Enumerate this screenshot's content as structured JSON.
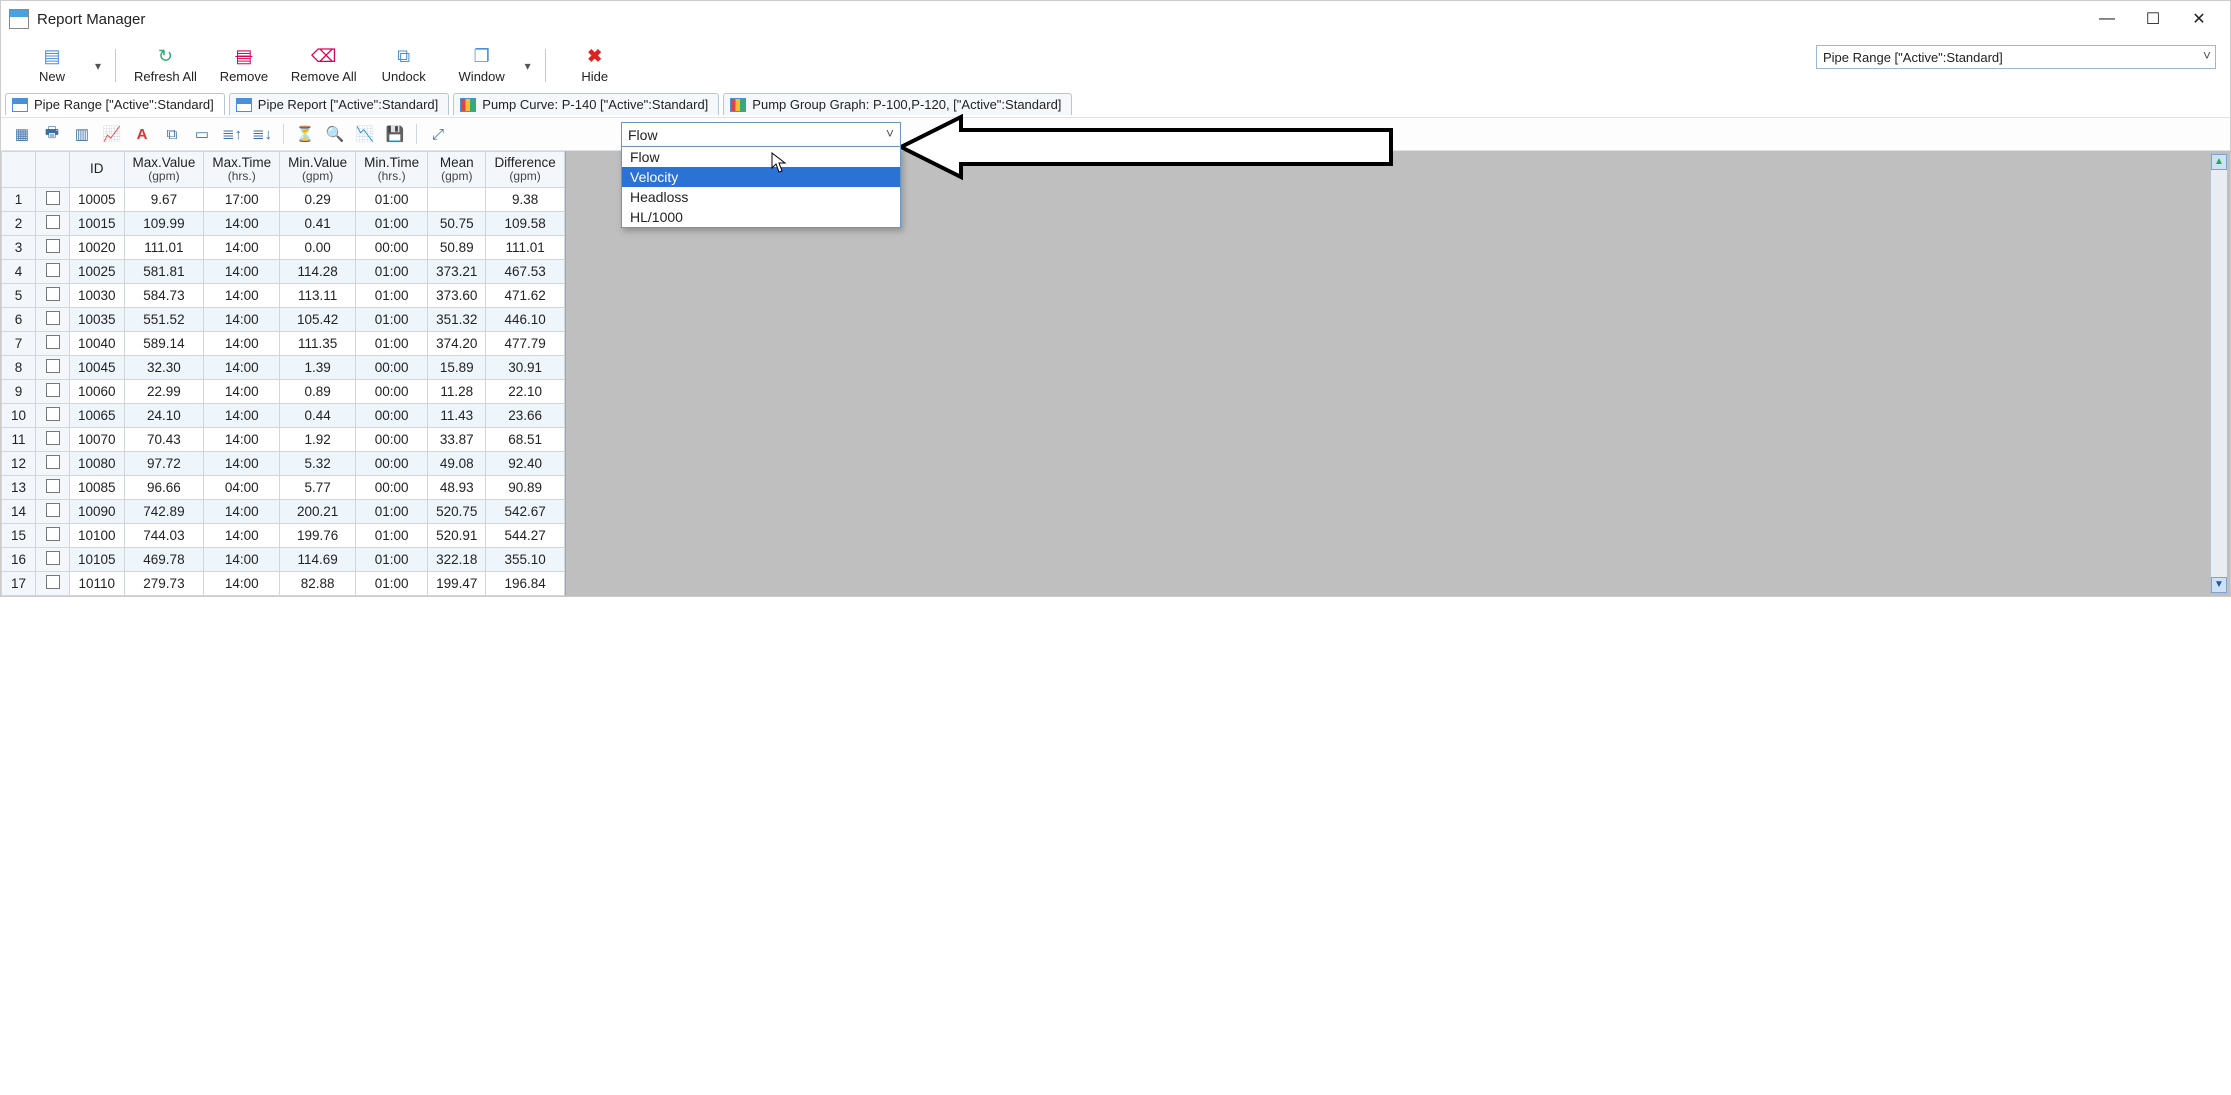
{
  "window": {
    "title": "Report Manager"
  },
  "toolbar": {
    "new": "New",
    "refresh_all": "Refresh All",
    "remove": "Remove",
    "remove_all": "Remove All",
    "undock": "Undock",
    "window": "Window",
    "hide": "Hide"
  },
  "top_combo": {
    "value": "Pipe Range [\"Active\":Standard]"
  },
  "tabs": [
    {
      "label": "Pipe Range [\"Active\":Standard]",
      "type": "table",
      "active": true
    },
    {
      "label": "Pipe Report [\"Active\":Standard]",
      "type": "table",
      "active": false
    },
    {
      "label": "Pump Curve: P-140 [\"Active\":Standard]",
      "type": "chart",
      "active": false
    },
    {
      "label": "Pump Group Graph: P-100,P-120, [\"Active\":Standard]",
      "type": "chart",
      "active": false
    }
  ],
  "attr_combo": {
    "selected": "Flow",
    "options": [
      "Flow",
      "Velocity",
      "Headloss",
      "HL/1000"
    ],
    "highlighted_index": 1
  },
  "columns": [
    {
      "title": "ID",
      "sub": ""
    },
    {
      "title": "Max.Value",
      "sub": "(gpm)"
    },
    {
      "title": "Max.Time",
      "sub": "(hrs.)"
    },
    {
      "title": "Min.Value",
      "sub": "(gpm)"
    },
    {
      "title": "Min.Time",
      "sub": "(hrs.)"
    },
    {
      "title": "Mean",
      "sub": "(gpm)"
    },
    {
      "title": "Difference",
      "sub": "(gpm)"
    }
  ],
  "rows": [
    {
      "n": 1,
      "id": "10005",
      "maxv": "9.67",
      "maxt": "17:00",
      "minv": "0.29",
      "mint": "01:00",
      "mean": "",
      "diff": "9.38"
    },
    {
      "n": 2,
      "id": "10015",
      "maxv": "109.99",
      "maxt": "14:00",
      "minv": "0.41",
      "mint": "01:00",
      "mean": "50.75",
      "diff": "109.58"
    },
    {
      "n": 3,
      "id": "10020",
      "maxv": "111.01",
      "maxt": "14:00",
      "minv": "0.00",
      "mint": "00:00",
      "mean": "50.89",
      "diff": "111.01"
    },
    {
      "n": 4,
      "id": "10025",
      "maxv": "581.81",
      "maxt": "14:00",
      "minv": "114.28",
      "mint": "01:00",
      "mean": "373.21",
      "diff": "467.53"
    },
    {
      "n": 5,
      "id": "10030",
      "maxv": "584.73",
      "maxt": "14:00",
      "minv": "113.11",
      "mint": "01:00",
      "mean": "373.60",
      "diff": "471.62"
    },
    {
      "n": 6,
      "id": "10035",
      "maxv": "551.52",
      "maxt": "14:00",
      "minv": "105.42",
      "mint": "01:00",
      "mean": "351.32",
      "diff": "446.10"
    },
    {
      "n": 7,
      "id": "10040",
      "maxv": "589.14",
      "maxt": "14:00",
      "minv": "111.35",
      "mint": "01:00",
      "mean": "374.20",
      "diff": "477.79"
    },
    {
      "n": 8,
      "id": "10045",
      "maxv": "32.30",
      "maxt": "14:00",
      "minv": "1.39",
      "mint": "00:00",
      "mean": "15.89",
      "diff": "30.91"
    },
    {
      "n": 9,
      "id": "10060",
      "maxv": "22.99",
      "maxt": "14:00",
      "minv": "0.89",
      "mint": "00:00",
      "mean": "11.28",
      "diff": "22.10"
    },
    {
      "n": 10,
      "id": "10065",
      "maxv": "24.10",
      "maxt": "14:00",
      "minv": "0.44",
      "mint": "00:00",
      "mean": "11.43",
      "diff": "23.66"
    },
    {
      "n": 11,
      "id": "10070",
      "maxv": "70.43",
      "maxt": "14:00",
      "minv": "1.92",
      "mint": "00:00",
      "mean": "33.87",
      "diff": "68.51"
    },
    {
      "n": 12,
      "id": "10080",
      "maxv": "97.72",
      "maxt": "14:00",
      "minv": "5.32",
      "mint": "00:00",
      "mean": "49.08",
      "diff": "92.40"
    },
    {
      "n": 13,
      "id": "10085",
      "maxv": "96.66",
      "maxt": "04:00",
      "minv": "5.77",
      "mint": "00:00",
      "mean": "48.93",
      "diff": "90.89"
    },
    {
      "n": 14,
      "id": "10090",
      "maxv": "742.89",
      "maxt": "14:00",
      "minv": "200.21",
      "mint": "01:00",
      "mean": "520.75",
      "diff": "542.67"
    },
    {
      "n": 15,
      "id": "10100",
      "maxv": "744.03",
      "maxt": "14:00",
      "minv": "199.76",
      "mint": "01:00",
      "mean": "520.91",
      "diff": "544.27"
    },
    {
      "n": 16,
      "id": "10105",
      "maxv": "469.78",
      "maxt": "14:00",
      "minv": "114.69",
      "mint": "01:00",
      "mean": "322.18",
      "diff": "355.10"
    },
    {
      "n": 17,
      "id": "10110",
      "maxv": "279.73",
      "maxt": "14:00",
      "minv": "82.88",
      "mint": "01:00",
      "mean": "199.47",
      "diff": "196.84"
    }
  ]
}
